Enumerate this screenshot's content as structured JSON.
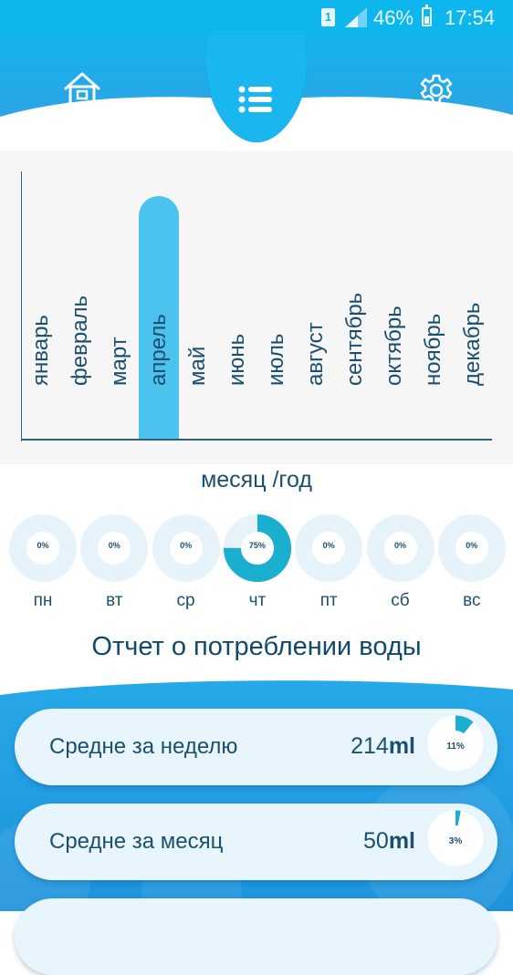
{
  "status_bar": {
    "sim": "1",
    "battery_pct": "46%",
    "time": "17:54",
    "battery_level": 0.46
  },
  "nav": {
    "home_icon": "home-icon",
    "list_icon": "list-icon",
    "settings_icon": "gear-icon",
    "accent": "#0db7ee"
  },
  "chart_data": {
    "type": "bar",
    "categories": [
      "январь",
      "февраль",
      "март",
      "апрель",
      "май",
      "июнь",
      "июль",
      "август",
      "сентябрь",
      "октябрь",
      "ноябрь",
      "декабрь"
    ],
    "values": [
      0,
      0,
      0,
      1,
      0,
      0,
      0,
      0,
      0,
      0,
      0,
      0
    ],
    "ylim": [
      0,
      1
    ],
    "highlight_index": 3,
    "bar_color": "#4cc3ef",
    "xlabel": "месяц /год"
  },
  "week": {
    "days": [
      {
        "label": "пн",
        "percent": "0%",
        "value": 0
      },
      {
        "label": "вт",
        "percent": "0%",
        "value": 0
      },
      {
        "label": "ср",
        "percent": "0%",
        "value": 0
      },
      {
        "label": "чт",
        "percent": "75%",
        "value": 0.75
      },
      {
        "label": "пт",
        "percent": "0%",
        "value": 0
      },
      {
        "label": "сб",
        "percent": "0%",
        "value": 0
      },
      {
        "label": "вс",
        "percent": "0%",
        "value": 0
      }
    ]
  },
  "report": {
    "title": "Отчет о потреблении воды",
    "items": [
      {
        "label": "Средне за неделю",
        "value": "214",
        "unit": "ml",
        "percent": "11%",
        "fraction": 0.11
      },
      {
        "label": "Средне за месяц",
        "value": "50",
        "unit": "ml",
        "percent": "3%",
        "fraction": 0.03
      }
    ]
  }
}
